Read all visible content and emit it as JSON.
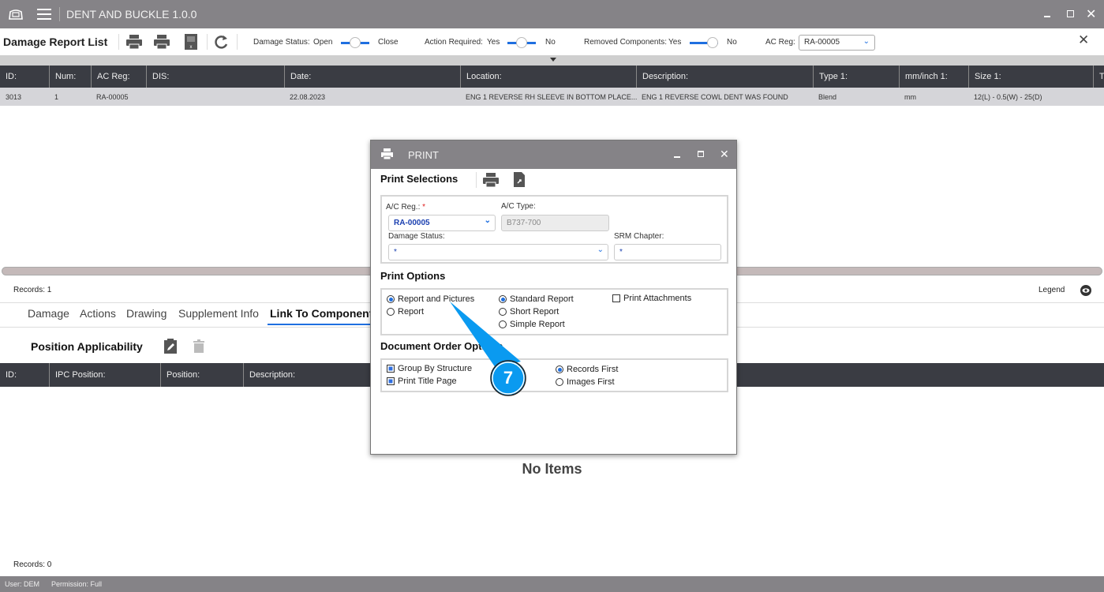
{
  "app": {
    "title": "DENT AND BUCKLE 1.0.0"
  },
  "toolbar": {
    "title": "Damage Report List",
    "damage_status_label": "Damage Status:",
    "damage_status_on": "Open",
    "damage_status_off": "Close",
    "action_required_label": "Action Required:",
    "action_yes": "Yes",
    "action_no": "No",
    "removed_label": "Removed Components:",
    "removed_yes": "Yes",
    "removed_no": "No",
    "ac_reg_label": "AC Reg:",
    "ac_reg_value": "RA-00005"
  },
  "table": {
    "columns": [
      "ID:",
      "Num:",
      "AC Reg:",
      "DIS:",
      "Date:",
      "Location:",
      "Description:",
      "Type 1:",
      "mm/inch 1:",
      "Size 1:",
      "T"
    ],
    "rows": [
      [
        "3013",
        "1",
        "RA-00005",
        "",
        "22.08.2023",
        "ENG 1 REVERSE RH SLEEVE IN BOTTOM PLACE...",
        "ENG 1 REVERSE COWL DENT WAS FOUND",
        "Blend",
        "mm",
        "12(L) - 0.5(W) - 25(D)",
        ""
      ]
    ],
    "records": "Records: 1",
    "legend": "Legend"
  },
  "tabs": [
    "Damage",
    "Actions",
    "Drawing",
    "Supplement Info",
    "Link To Components"
  ],
  "position": {
    "title": "Position Applicability",
    "columns": [
      "ID:",
      "IPC Position:",
      "Position:",
      "Description:"
    ],
    "empty": "No Items",
    "records": "Records: 0"
  },
  "status": {
    "user": "User: DEM",
    "permission": "Permission: Full"
  },
  "print": {
    "title": "PRINT",
    "selections": "Print Selections",
    "ac_reg_label": "A/C Reg.:",
    "required": "*",
    "ac_reg": "RA-00005",
    "ac_type_label": "A/C Type:",
    "ac_type": "B737-700",
    "damage_status_label": "Damage Status:",
    "damage_status": "*",
    "srm_label": "SRM Chapter:",
    "srm": "*",
    "options_title": "Print Options",
    "report_and_pictures": "Report and Pictures",
    "report": "Report",
    "standard": "Standard Report",
    "short": "Short Report",
    "simple": "Simple Report",
    "attachments": "Print Attachments",
    "order_title": "Document Order Options",
    "group": "Group By Structure",
    "title_page": "Print Title Page",
    "records_first": "Records First",
    "images_first": "Images First"
  },
  "callout": {
    "number": "7",
    "color": "#0a9af0"
  }
}
